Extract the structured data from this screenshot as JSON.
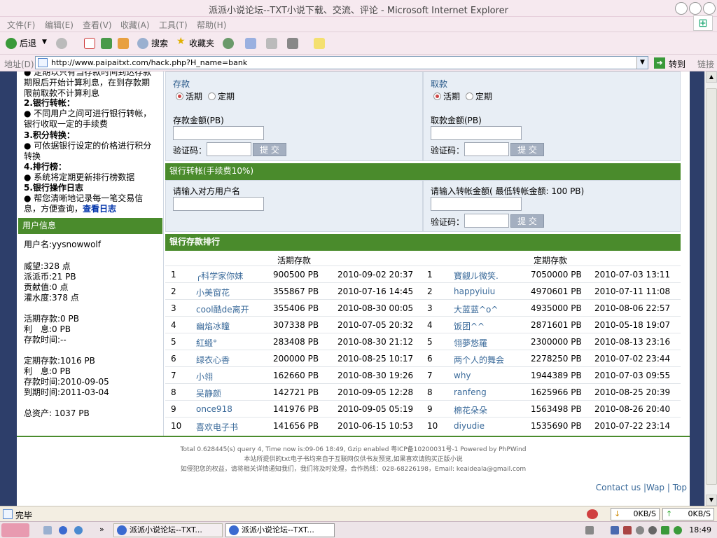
{
  "window": {
    "title": "派派小说论坛--TXT小说下载、交流、评论 - Microsoft Internet Explorer"
  },
  "menu": [
    "文件(F)",
    "编辑(E)",
    "查看(V)",
    "收藏(A)",
    "工具(T)",
    "帮助(H)"
  ],
  "toolbar": {
    "back": "后退",
    "search": "搜索",
    "favorites": "收藏夹"
  },
  "address": {
    "label": "地址(D)",
    "url": "http://www.paipaitxt.com/hack.php?H_name=bank",
    "go": "转到",
    "links": "链接"
  },
  "left": {
    "intro1": "● 定期以只有当存款时间到达存款期限后开始计算利息，在到存款期限前取款不计算利息",
    "h2": "2.银行转帐：",
    "p2": "● 不同用户之间可进行银行转帐，银行收取一定的手续费",
    "h3": "3.积分转换：",
    "p3": "● 可依据银行设定的价格进行积分转换",
    "h4": "4.排行榜：",
    "p4": "● 系统将定期更新排行榜数据",
    "h5": "5.银行操作日志",
    "p5": "● 帮您清晰地记录每一笔交易信息，方便查询，",
    "log_link": "查看日志",
    "userinfo_title": "用户信息",
    "username": "用户名:yysnowwolf",
    "weiwang": "威望:328 点",
    "paipaibi": "派派币:21 PB",
    "gongxian": "贡献值:0 点",
    "guanshui": "灌水度:378 点",
    "huoqi": "活期存款:0 PB",
    "huoqi_li": "利　息:0 PB",
    "huoqi_time": "存款时间:--",
    "dingqi": "定期存款:1016 PB",
    "dingqi_li": "利　息:0 PB",
    "dingqi_time": "存款时间:2010-09-05",
    "daoqi_time": "到期时间:2011-03-04",
    "total": "总资产: 1037 PB"
  },
  "deposit": {
    "title": "存款",
    "opt1": "活期",
    "opt2": "定期",
    "amount_label": "存款金额(PB)",
    "captcha": "验证码：",
    "submit": "提 交"
  },
  "withdraw": {
    "title": "取款",
    "opt1": "活期",
    "opt2": "定期",
    "amount_label": "取款金额(PB)",
    "captcha": "验证码：",
    "submit": "提 交"
  },
  "transfer": {
    "title": "银行转帐(手续费10%)",
    "user_label": "请输入对方用户名",
    "amount_label": "请输入转帐金额( 最低转帐金额: 100 PB)",
    "captcha": "验证码：",
    "submit": "提 交"
  },
  "ranking": {
    "title": "银行存款排行",
    "col_huoqi": "活期存款",
    "col_dingqi": "定期存款",
    "rows": [
      {
        "n": "1",
        "u1": "╭科学家你妹",
        "a1": "900500 PB",
        "d1": "2010-09-02 20:37",
        "m": "1",
        "u2": "寳觎ル微笑.",
        "a2": "7050000 PB",
        "d2": "2010-07-03 13:11"
      },
      {
        "n": "2",
        "u1": "小美窗花",
        "a1": "355867 PB",
        "d1": "2010-07-16 14:45",
        "m": "2",
        "u2": "happyiuiu",
        "a2": "4970601 PB",
        "d2": "2010-07-11 11:08"
      },
      {
        "n": "3",
        "u1": "cool酷de离开",
        "a1": "355406 PB",
        "d1": "2010-08-30 00:05",
        "m": "3",
        "u2": "大蓝蓝^o^",
        "a2": "4935000 PB",
        "d2": "2010-08-06 22:57"
      },
      {
        "n": "4",
        "u1": "幽焰冰瞳",
        "a1": "307338 PB",
        "d1": "2010-07-05 20:32",
        "m": "4",
        "u2": "饭团^^",
        "a2": "2871601 PB",
        "d2": "2010-05-18 19:07"
      },
      {
        "n": "5",
        "u1": "紅緞°",
        "a1": "283408 PB",
        "d1": "2010-08-30 21:12",
        "m": "5",
        "u2": "翎夢悠羅",
        "a2": "2300000 PB",
        "d2": "2010-08-13 23:16"
      },
      {
        "n": "6",
        "u1": "绿衣心香",
        "a1": "200000 PB",
        "d1": "2010-08-25 10:17",
        "m": "6",
        "u2": "两个人的舞会",
        "a2": "2278250 PB",
        "d2": "2010-07-02 23:44"
      },
      {
        "n": "7",
        "u1": "小翎",
        "a1": "162660 PB",
        "d1": "2010-08-30 19:26",
        "m": "7",
        "u2": "why",
        "a2": "1944389 PB",
        "d2": "2010-07-03 09:55"
      },
      {
        "n": "8",
        "u1": "吴静颜",
        "a1": "142721 PB",
        "d1": "2010-09-05 12:28",
        "m": "8",
        "u2": "ranfeng",
        "a2": "1625966 PB",
        "d2": "2010-08-25 20:39"
      },
      {
        "n": "9",
        "u1": "once918",
        "a1": "141976 PB",
        "d1": "2010-09-05 05:19",
        "m": "9",
        "u2": "棉花朵朵",
        "a2": "1563498 PB",
        "d2": "2010-08-26 20:40"
      },
      {
        "n": "10",
        "u1": "喜欢电子书",
        "a1": "141656 PB",
        "d1": "2010-06-15 10:53",
        "m": "10",
        "u2": "diyudie",
        "a2": "1535690 PB",
        "d2": "2010-07-22 23:14"
      }
    ]
  },
  "footer": {
    "line1": "Total 0.628445(s) query 4, Time now is:09-06 18:49, Gzip enabled 粤ICP备10200031号-1 Powered by PhPWind",
    "line2": "本站所提供的txt电子书均来自于互联网仅供书友预览,如果喜欢请购买正版小说",
    "line3": "如侵犯您的权益，请将相关详情通知我们，我们将及时处理，合作热线：028-68226198，Email: keaideala@gmail.com",
    "contact": "Contact us",
    "wap": "Wap",
    "top": "Top"
  },
  "status": {
    "text": "完毕",
    "down": "0KB/S",
    "up": "0KB/S"
  },
  "taskbar": {
    "task1": "派派小说论坛--TXT...",
    "task2": "派派小说论坛--TXT...",
    "clock": "18:49"
  }
}
